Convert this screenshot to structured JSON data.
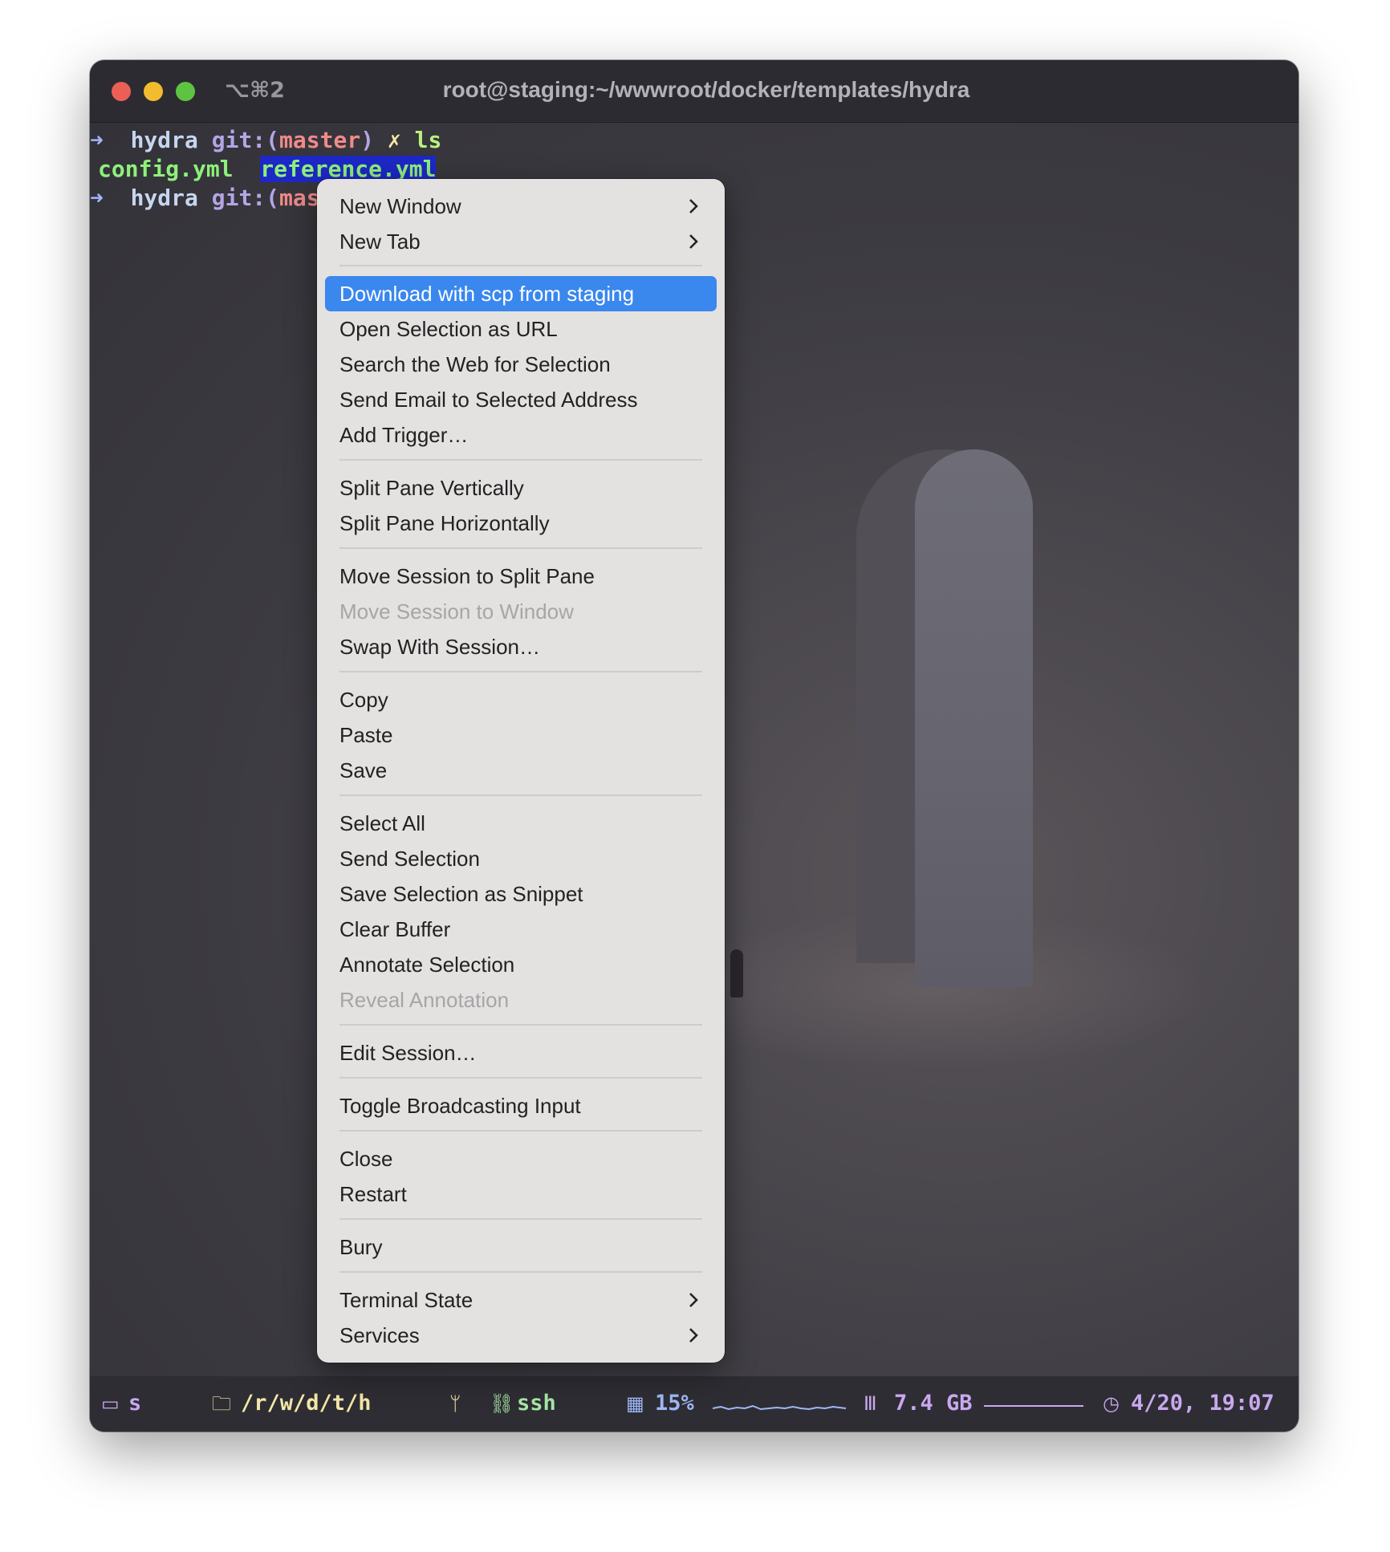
{
  "window": {
    "shortcut": "⌥⌘2",
    "title": "root@staging:~/wwwroot/docker/templates/hydra"
  },
  "terminal": {
    "prompt_arrow": "➜",
    "line1": {
      "dir": "hydra",
      "git": "git:(",
      "branch": "master",
      "git_close": ")",
      "dirty": "✗",
      "cmd": "ls"
    },
    "line2": {
      "file1": "config.yml",
      "file2": "reference.yml"
    },
    "line3": {
      "dir": "hydra",
      "git": "git:(",
      "branch_partial": "mas"
    }
  },
  "menu": {
    "items": [
      {
        "label": "New Window",
        "submenu": true
      },
      {
        "label": "New Tab",
        "submenu": true
      },
      {
        "label": "Download with scp from staging",
        "highlighted": true
      },
      {
        "label": "Open Selection as URL"
      },
      {
        "label": "Search the Web for Selection"
      },
      {
        "label": "Send Email to Selected Address"
      },
      {
        "label": "Add Trigger…"
      },
      {
        "label": "Split Pane Vertically"
      },
      {
        "label": "Split Pane Horizontally"
      },
      {
        "label": "Move Session to Split Pane"
      },
      {
        "label": "Move Session to Window",
        "disabled": true
      },
      {
        "label": "Swap With Session…"
      },
      {
        "label": "Copy"
      },
      {
        "label": "Paste"
      },
      {
        "label": "Save"
      },
      {
        "label": "Select All"
      },
      {
        "label": "Send Selection"
      },
      {
        "label": "Save Selection as Snippet"
      },
      {
        "label": "Clear Buffer"
      },
      {
        "label": "Annotate Selection"
      },
      {
        "label": "Reveal Annotation",
        "disabled": true
      },
      {
        "label": "Edit Session…"
      },
      {
        "label": "Toggle Broadcasting Input"
      },
      {
        "label": "Close"
      },
      {
        "label": "Restart"
      },
      {
        "label": "Bury"
      },
      {
        "label": "Terminal State",
        "submenu": true
      },
      {
        "label": "Services",
        "submenu": true
      }
    ]
  },
  "statusbar": {
    "host": "s",
    "path": "/r/w/d/t/h",
    "job": "ssh",
    "cpu": "15%",
    "memory": "7.4 GB",
    "clock": "4/20, 19:07"
  },
  "colors": {
    "accent": "#3a87ee",
    "selection_bg": "#1d28c6",
    "file_green": "#8ef07a",
    "branch_red": "#f08a8a",
    "status_yellow": "#f3e7a8",
    "status_blue": "#9fb8f5",
    "status_green": "#a6e6a6",
    "status_purple": "#c9a8f0"
  }
}
